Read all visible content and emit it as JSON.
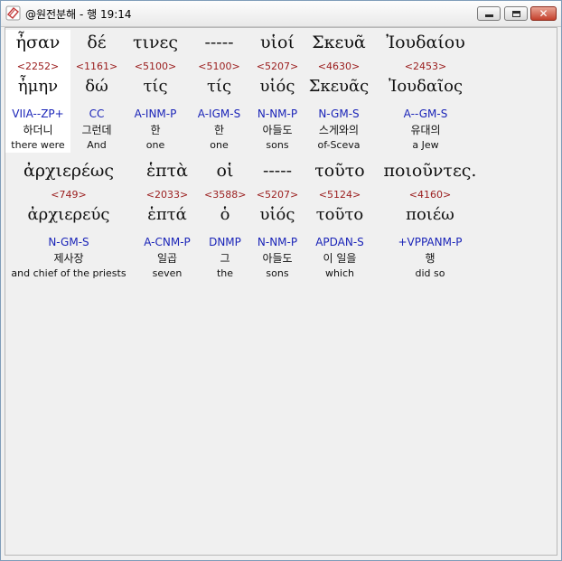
{
  "window": {
    "title": "@원전분해 - 행 19:14",
    "minimize_label": "",
    "maximize_label": "",
    "close_label": "✕"
  },
  "rows": [
    {
      "words": [
        {
          "greek": "ἦσαν",
          "strong": "<2252>",
          "lemma": "ἦμην",
          "parse": "VIIA--ZP+",
          "korean": "하더니",
          "english": "there were",
          "selected": true
        },
        {
          "greek": "δέ",
          "strong": "<1161>",
          "lemma": "δώ",
          "parse": "CC",
          "korean": "그런데",
          "english": "And"
        },
        {
          "greek": "τινες",
          "strong": "<5100>",
          "lemma": "τίς",
          "parse": "A-INM-P",
          "korean": "한",
          "english": "one"
        },
        {
          "greek": "-----",
          "strong": "<5100>",
          "lemma": "τίς",
          "parse": "A-IGM-S",
          "korean": "한",
          "english": "one"
        },
        {
          "greek": "υἱοί",
          "strong": "<5207>",
          "lemma": "υἱός",
          "parse": "N-NM-P",
          "korean": "아들도",
          "english": "sons"
        },
        {
          "greek": "Σκευᾶ",
          "strong": "<4630>",
          "lemma": "Σκευᾶς",
          "parse": "N-GM-S",
          "korean": "스게와의",
          "english": "of-Sceva"
        },
        {
          "greek": "Ἰουδαίου",
          "strong": "<2453>",
          "lemma": "Ἰουδαῖος",
          "parse": "A--GM-S",
          "korean": "유대의",
          "english": "a Jew"
        }
      ]
    },
    {
      "words": [
        {
          "greek": "ἀρχιερέως",
          "strong": "<749>",
          "lemma": "ἀρχιερεύς",
          "parse": "N-GM-S",
          "korean": "제사장",
          "english": "and chief of the priests"
        },
        {
          "greek": "ἑπτὰ",
          "strong": "<2033>",
          "lemma": "ἑπτά",
          "parse": "A-CNM-P",
          "korean": "일곱",
          "english": "seven"
        },
        {
          "greek": "οἱ",
          "strong": "<3588>",
          "lemma": "ὁ",
          "parse": "DNMP",
          "korean": "그",
          "english": "the"
        },
        {
          "greek": "-----",
          "strong": "<5207>",
          "lemma": "υἱός",
          "parse": "N-NM-P",
          "korean": "아들도",
          "english": "sons"
        },
        {
          "greek": "τοῦτο",
          "strong": "<5124>",
          "lemma": "τοῦτο",
          "parse": "APDAN-S",
          "korean": "이 일을",
          "english": "which"
        },
        {
          "greek": "ποιοῦντες.",
          "strong": "<4160>",
          "lemma": "ποιέω",
          "parse": "+VPPANM-P",
          "korean": "행",
          "english": "did so"
        }
      ]
    }
  ]
}
